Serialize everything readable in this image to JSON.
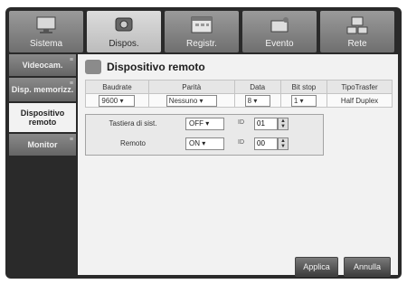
{
  "tabs": [
    {
      "label": "Sistema",
      "icon": "monitor-icon"
    },
    {
      "label": "Dispos.",
      "icon": "camera-icon"
    },
    {
      "label": "Registr.",
      "icon": "calendar-icon"
    },
    {
      "label": "Evento",
      "icon": "alarm-icon"
    },
    {
      "label": "Rete",
      "icon": "network-icon"
    }
  ],
  "sidebar": {
    "items": [
      {
        "label": "Videocam."
      },
      {
        "label": "Disp. memorizz."
      },
      {
        "label": "Dispositivo remoto"
      },
      {
        "label": "Monitor"
      }
    ]
  },
  "panel": {
    "title": "Dispositivo remoto",
    "grid": {
      "headers": [
        "Baudrate",
        "Parità",
        "Data",
        "Bit stop",
        "TipoTrasfer"
      ],
      "values": [
        "9600",
        "Nessuno",
        "8",
        "1",
        "Half Duplex"
      ]
    },
    "keyboard": {
      "label": "Tastiera di sist.",
      "value": "OFF",
      "id_label": "ID",
      "id_value": "01"
    },
    "remote": {
      "label": "Remoto",
      "value": "ON",
      "id_label": "ID",
      "id_value": "00"
    },
    "buttons": {
      "apply": "Applica",
      "cancel": "Annulla"
    }
  }
}
